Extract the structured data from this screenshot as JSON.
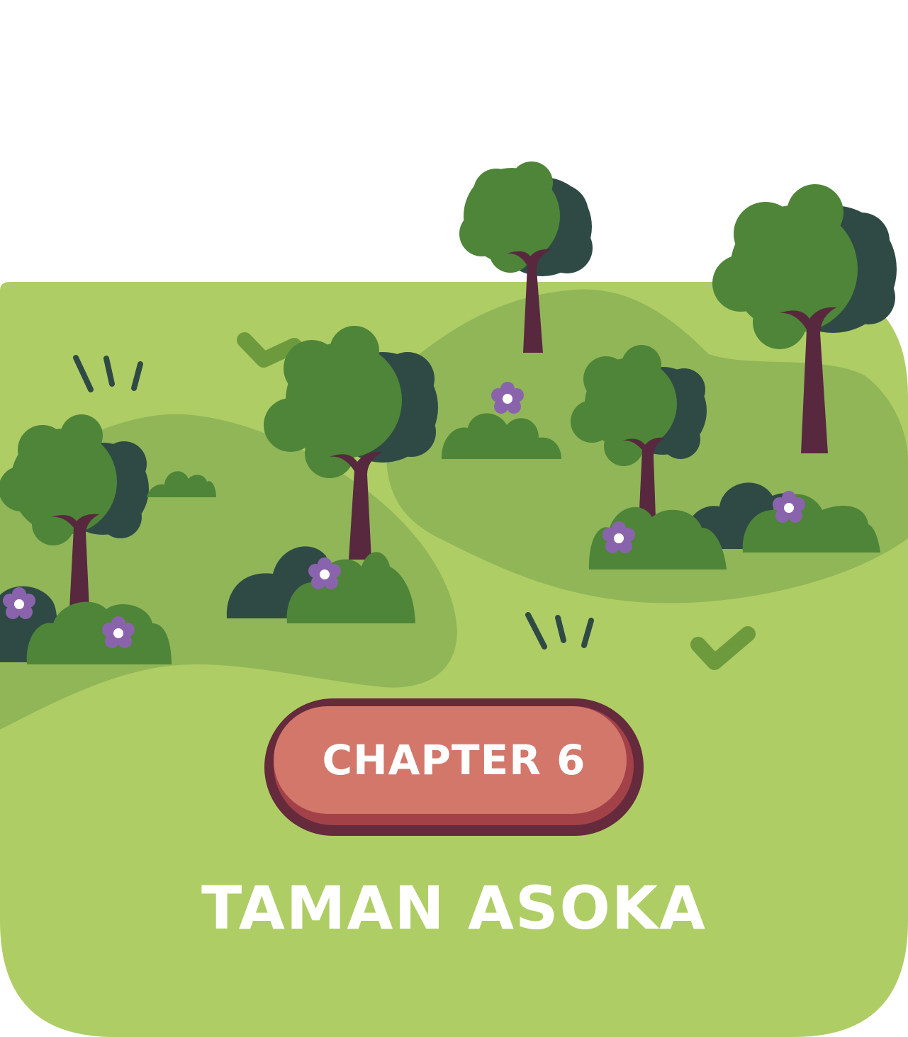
{
  "chapter": {
    "label": "CHAPTER 6",
    "title": "TAMAN ASOKA"
  },
  "colors": {
    "card_background": "#afcd65",
    "hill": "#90b658",
    "tree_foliage": "#4e8538",
    "tree_shadow": "#2f4a45",
    "trunk": "#58283e",
    "bush": "#4e8538",
    "flower": "#8a63ad",
    "button_fill": "#d3776a",
    "button_border": "#652a3b",
    "button_shadow": "#a34149",
    "text": "#ffffff"
  }
}
